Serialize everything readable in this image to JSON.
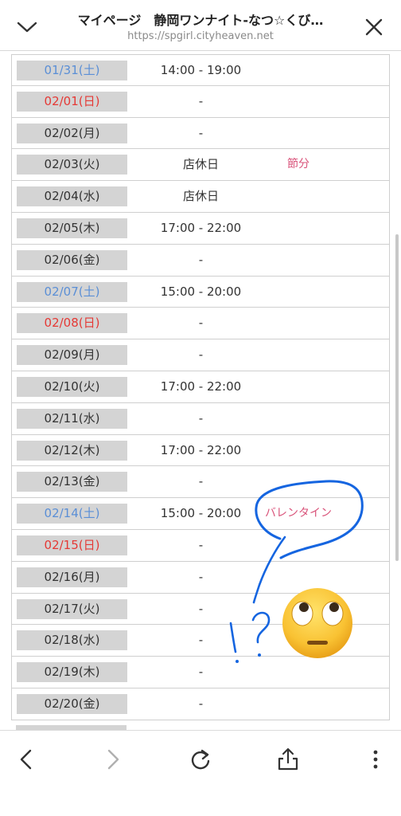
{
  "header": {
    "title": "マイページ　静岡ワンナイト-なつ☆くび…",
    "url": "https://spgirl.cityheaven.net",
    "close_icon": "close-icon",
    "collapse_icon": "chevron-down-icon"
  },
  "schedule": [
    {
      "date": "01/31(土)",
      "day_type": "sat",
      "time": "14:00 - 19:00",
      "note": ""
    },
    {
      "date": "02/01(日)",
      "day_type": "sun",
      "time": "-",
      "note": ""
    },
    {
      "date": "02/02(月)",
      "day_type": "weekday",
      "time": "-",
      "note": ""
    },
    {
      "date": "02/03(火)",
      "day_type": "weekday",
      "time": "店休日",
      "note": "節分"
    },
    {
      "date": "02/04(水)",
      "day_type": "weekday",
      "time": "店休日",
      "note": ""
    },
    {
      "date": "02/05(木)",
      "day_type": "weekday",
      "time": "17:00 - 22:00",
      "note": ""
    },
    {
      "date": "02/06(金)",
      "day_type": "weekday",
      "time": "-",
      "note": ""
    },
    {
      "date": "02/07(土)",
      "day_type": "sat",
      "time": "15:00 - 20:00",
      "note": ""
    },
    {
      "date": "02/08(日)",
      "day_type": "sun",
      "time": "-",
      "note": ""
    },
    {
      "date": "02/09(月)",
      "day_type": "weekday",
      "time": "-",
      "note": ""
    },
    {
      "date": "02/10(火)",
      "day_type": "weekday",
      "time": "17:00 - 22:00",
      "note": ""
    },
    {
      "date": "02/11(水)",
      "day_type": "weekday",
      "time": "-",
      "note": ""
    },
    {
      "date": "02/12(木)",
      "day_type": "weekday",
      "time": "17:00 - 22:00",
      "note": ""
    },
    {
      "date": "02/13(金)",
      "day_type": "weekday",
      "time": "-",
      "note": ""
    },
    {
      "date": "02/14(土)",
      "day_type": "sat",
      "time": "15:00 - 20:00",
      "note": "バレンタイン"
    },
    {
      "date": "02/15(日)",
      "day_type": "sun",
      "time": "-",
      "note": ""
    },
    {
      "date": "02/16(月)",
      "day_type": "weekday",
      "time": "-",
      "note": ""
    },
    {
      "date": "02/17(火)",
      "day_type": "weekday",
      "time": "-",
      "note": ""
    },
    {
      "date": "02/18(水)",
      "day_type": "weekday",
      "time": "-",
      "note": ""
    },
    {
      "date": "02/19(木)",
      "day_type": "weekday",
      "time": "-",
      "note": ""
    },
    {
      "date": "02/20(金)",
      "day_type": "weekday",
      "time": "-",
      "note": ""
    }
  ],
  "colors": {
    "saturday": "#5b8fd6",
    "sunday": "#e53935",
    "note": "#d9537a",
    "scribble": "#1565e0"
  },
  "annotation": {
    "scribble_text": "!?",
    "emoji": "face-with-rolling-eyes"
  },
  "toolbar": {
    "back_icon": "back-arrow-icon",
    "forward_icon": "forward-arrow-icon",
    "reload_icon": "reload-icon",
    "share_icon": "share-icon",
    "more_icon": "more-vertical-icon"
  }
}
